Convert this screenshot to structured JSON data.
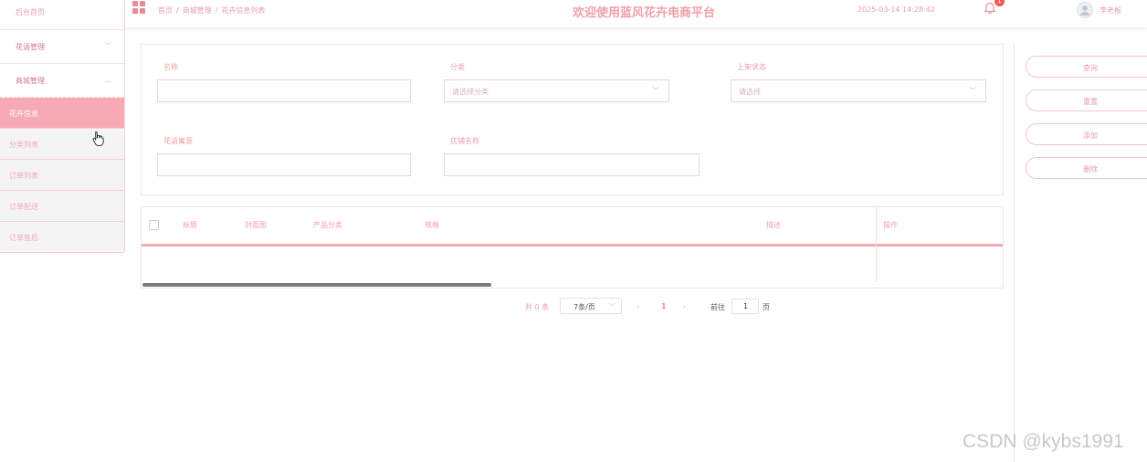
{
  "header": {
    "breadcrumb": [
      "首页",
      "商城管理",
      "花卉信息列表"
    ],
    "breadcrumb_separator": "/",
    "title": "欢迎使用蓝风花卉电商平台",
    "datetime": "2025-03-14 14:28:42",
    "notification_count": "1",
    "username": "李老板"
  },
  "sidebar": {
    "home": "后台首页",
    "menus": [
      {
        "label": "花语管理",
        "chevron": "﹀"
      },
      {
        "label": "商城管理",
        "chevron": "︿"
      }
    ],
    "submenu": [
      {
        "label": "花卉信息",
        "active": true
      },
      {
        "label": "分类列表",
        "active": false
      },
      {
        "label": "订单列表",
        "active": false
      },
      {
        "label": "订单配送",
        "active": false
      },
      {
        "label": "订单售后",
        "active": false
      }
    ]
  },
  "filters": {
    "name_label": "名称",
    "name_value": "",
    "category_label": "分类",
    "category_placeholder": "请选择分类",
    "status_label": "上架状态",
    "status_placeholder": "请选择",
    "meaning_label": "花语寓意",
    "meaning_value": "",
    "shop_label": "店铺名称",
    "shop_value": ""
  },
  "actions": [
    "查询",
    "重置",
    "添加",
    "删除"
  ],
  "table": {
    "columns": [
      "标题",
      "封面图",
      "产品分类",
      "规格",
      "描述",
      "操作"
    ],
    "rows": []
  },
  "pagination": {
    "total": "共 0 条",
    "page_size": "7条/页",
    "prev": "‹",
    "current": "1",
    "next": "›",
    "goto_label": "前往",
    "goto_value": "1",
    "page_unit": "页"
  },
  "watermark": "CSDN @kybs1991",
  "colors": {
    "accent": "#f7aab6",
    "accent_text": "#e8a0a8",
    "title": "#f0a0aa",
    "badge": "#f15b5b"
  }
}
